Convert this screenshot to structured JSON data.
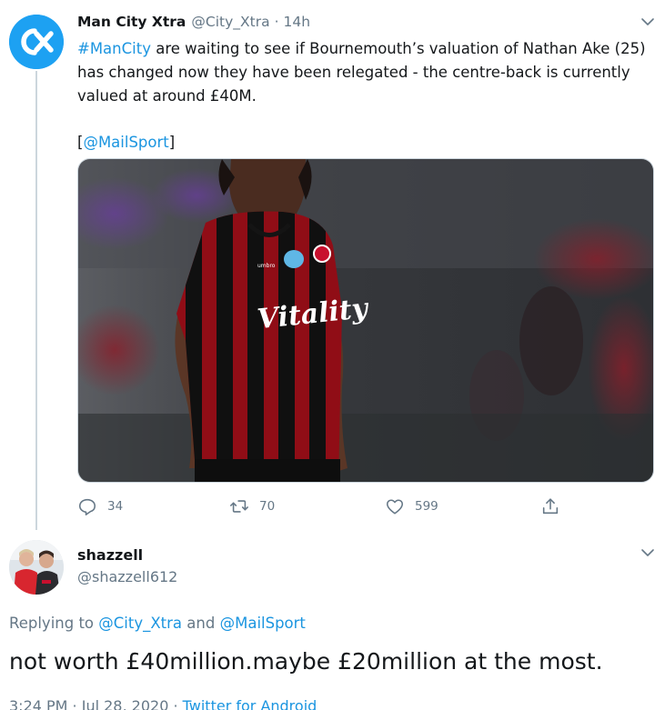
{
  "tweet": {
    "author_name": "Man City Xtra",
    "handle": "@City_Xtra",
    "separator": "·",
    "time": "14h",
    "avatar_letters": "CX",
    "text": {
      "hashtag": "#ManCity",
      "line1_rest": " are waiting to see if Bournemouth’s valuation of Nathan Ake (25)",
      "line2": "has changed now they have been relegated - the centre-back is currently",
      "line3": "valued at around £40M.",
      "source_open": "[",
      "source_mention": "@MailSport",
      "source_close": "]"
    },
    "media": {
      "shirt_sponsor": "Vitality",
      "shirt_brand": "umbro"
    },
    "actions": {
      "reply_count": "34",
      "retweet_count": "70",
      "like_count": "599"
    }
  },
  "reply": {
    "author_name": "shazzell",
    "handle": "@shazzell612",
    "replying_prefix": "Replying to ",
    "replying_mention1": "@City_Xtra",
    "replying_and": " and ",
    "replying_mention2": "@MailSport",
    "text": "not worth £40million.maybe £20million at the most.",
    "meta_time": "3:24 PM",
    "meta_sep1": " · ",
    "meta_date": "Jul 28, 2020",
    "meta_sep2": " · ",
    "meta_source": "Twitter for Android"
  },
  "colors": {
    "accent": "#1da1f2",
    "link": "#1b95e0",
    "muted": "#657786",
    "text": "#14171a",
    "shirt_red": "#c8102e",
    "shirt_black": "#111111"
  },
  "icons": [
    "chevron-down-icon",
    "reply-icon",
    "retweet-icon",
    "like-icon",
    "share-icon"
  ]
}
